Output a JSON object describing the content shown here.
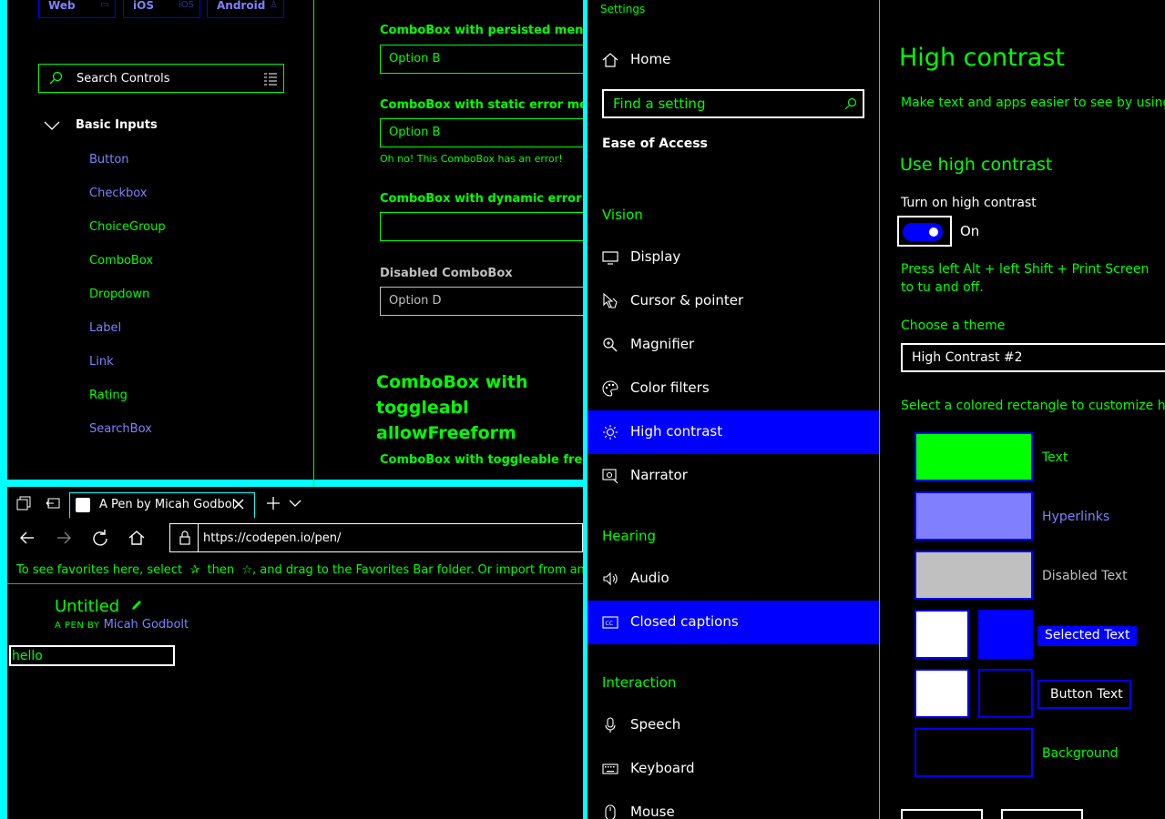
{
  "fluent_demo": {
    "platforms": [
      "Web",
      "iOS",
      "Android"
    ],
    "search_placeholder": "Search Controls",
    "section": "Basic Inputs",
    "nav_items": [
      {
        "label": "Button",
        "color": "#8080ff"
      },
      {
        "label": "Checkbox",
        "color": "#8080ff"
      },
      {
        "label": "ChoiceGroup",
        "color": "#00ff00"
      },
      {
        "label": "ComboBox",
        "color": "#00ff00"
      },
      {
        "label": "Dropdown",
        "color": "#00ff00"
      },
      {
        "label": "Label",
        "color": "#8080ff"
      },
      {
        "label": "Link",
        "color": "#8080ff"
      },
      {
        "label": "Rating",
        "color": "#00ff00"
      },
      {
        "label": "SearchBox",
        "color": "#8080ff"
      }
    ],
    "combos": {
      "persisted_title": "ComboBox with persisted menu",
      "persisted_value": "Option B",
      "static_error_title": "ComboBox with static error messag",
      "static_error_value": "Option B",
      "static_error_message": "Oh no! This ComboBox has an error!",
      "dynamic_error_title": "ComboBox with dynamic error mes",
      "dynamic_error_value": "",
      "disabled_title": "Disabled ComboBox",
      "disabled_value": "Option D",
      "toggleable_heading": "ComboBox with toggleabl allowFreeform",
      "toggleable_title": "ComboBox with toggleable freefor"
    }
  },
  "browser": {
    "tab_title": "A Pen by Micah Godbol",
    "url": "https://codepen.io/pen/",
    "favorites_message_1": "To see favorites here, select",
    "favorites_message_2": "then",
    "favorites_message_3": ", and drag to the Favorites Bar folder. Or import from another",
    "pen_title": "Untitled",
    "pen_by_prefix": "A PEN BY",
    "pen_author": "Micah Godbolt",
    "input_value": "hello"
  },
  "settings": {
    "window_title": "Settings",
    "home": "Home",
    "search_placeholder": "Find a setting",
    "category": "Ease of Access",
    "groups": {
      "vision": "Vision",
      "hearing": "Hearing",
      "interaction": "Interaction"
    },
    "vision_items": [
      "Display",
      "Cursor & pointer",
      "Magnifier",
      "Color filters",
      "High contrast",
      "Narrator"
    ],
    "hearing_items": [
      "Audio",
      "Closed captions"
    ],
    "interaction_items": [
      "Speech",
      "Keyboard",
      "Mouse"
    ],
    "selected_item": "High contrast",
    "page": {
      "title": "High contrast",
      "description": "Make text and apps easier to see by using m",
      "subtitle": "Use high contrast",
      "toggle_label": "Turn on high contrast",
      "toggle_state": "On",
      "toggle_on": true,
      "shortcut_text": "Press left Alt + left Shift + Print Screen to tu and off.",
      "theme_label": "Choose a theme",
      "theme_value": "High Contrast #2",
      "customize_text": "Select a colored rectangle to customize high",
      "swatches": {
        "text": {
          "label": "Text",
          "color": "#00ff00"
        },
        "hyperlinks": {
          "label": "Hyperlinks",
          "color": "#8080ff"
        },
        "disabled": {
          "label": "Disabled Text",
          "color": "#c0c0c0"
        },
        "selected": {
          "label": "Selected Text",
          "fg": "#ffffff",
          "bg": "#0000ff"
        },
        "button": {
          "label": "Button Text",
          "fg": "#ffffff",
          "bg": "#000000"
        },
        "background": {
          "label": "Background",
          "color": "#000000"
        }
      }
    }
  },
  "colors": {
    "accent_cyan": "#00ffff",
    "text_green": "#00ff00",
    "selection_blue": "#0000ff",
    "hyperlink": "#8080ff"
  }
}
